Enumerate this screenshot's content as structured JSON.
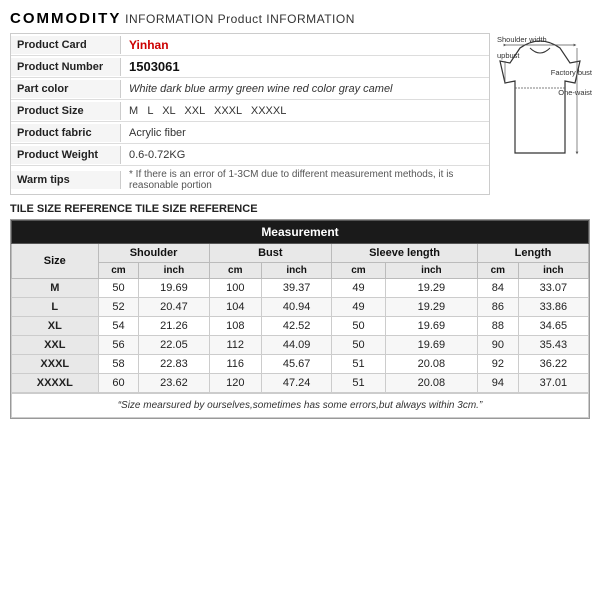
{
  "header": {
    "commodity_bold": "COMMODITY",
    "commodity_rest": " INFORMATION Product INFORMATION"
  },
  "product_info": {
    "rows": [
      {
        "label": "Product Card",
        "value": "Yinhan",
        "type": "highlight"
      },
      {
        "label": "Product Number",
        "value": "1503061",
        "type": "bold"
      },
      {
        "label": "Part color",
        "value": "White dark blue army green wine red color gray camel",
        "type": "part-color"
      },
      {
        "label": "Product Size",
        "value": "M  L  XL  XXL  XXXL  XXXXL",
        "type": "normal"
      },
      {
        "label": "Product fabric",
        "value": "Acrylic fiber",
        "type": "normal"
      },
      {
        "label": "Product Weight",
        "value": "0.6-0.72KG",
        "type": "normal"
      },
      {
        "label": "Warm tips",
        "value": "* If there is an error of 1-3CM due to different measurement methods, it is reasonable portion",
        "type": "warm-tips"
      }
    ]
  },
  "tile_reference": "TILE SIZE REFERENCE TILE SIZE REFERENCE",
  "table": {
    "main_header": "Measurement",
    "column_groups": [
      "Size",
      "Shoulder",
      "Bust",
      "Sleeve length",
      "Length"
    ],
    "unit_row": [
      "",
      "cm",
      "inch",
      "cm",
      "inch",
      "cm",
      "inch",
      "cm",
      "inch"
    ],
    "rows": [
      {
        "size": "M",
        "shoulder_cm": "50",
        "shoulder_in": "19.69",
        "bust_cm": "100",
        "bust_in": "39.37",
        "sleeve_cm": "49",
        "sleeve_in": "19.29",
        "length_cm": "84",
        "length_in": "33.07"
      },
      {
        "size": "L",
        "shoulder_cm": "52",
        "shoulder_in": "20.47",
        "bust_cm": "104",
        "bust_in": "40.94",
        "sleeve_cm": "49",
        "sleeve_in": "19.29",
        "length_cm": "86",
        "length_in": "33.86"
      },
      {
        "size": "XL",
        "shoulder_cm": "54",
        "shoulder_in": "21.26",
        "bust_cm": "108",
        "bust_in": "42.52",
        "sleeve_cm": "50",
        "sleeve_in": "19.69",
        "length_cm": "88",
        "length_in": "34.65"
      },
      {
        "size": "XXL",
        "shoulder_cm": "56",
        "shoulder_in": "22.05",
        "bust_cm": "112",
        "bust_in": "44.09",
        "sleeve_cm": "50",
        "sleeve_in": "19.69",
        "length_cm": "90",
        "length_in": "35.43"
      },
      {
        "size": "XXXL",
        "shoulder_cm": "58",
        "shoulder_in": "22.83",
        "bust_cm": "116",
        "bust_in": "45.67",
        "sleeve_cm": "51",
        "sleeve_in": "20.08",
        "length_cm": "92",
        "length_in": "36.22"
      },
      {
        "size": "XXXXL",
        "shoulder_cm": "60",
        "shoulder_in": "23.62",
        "bust_cm": "120",
        "bust_in": "47.24",
        "sleeve_cm": "51",
        "sleeve_in": "20.08",
        "length_cm": "94",
        "length_in": "37.01"
      }
    ],
    "note": "“Size mearsured by ourselves,sometimes has some errors,but always within 3cm.”"
  },
  "diagram": {
    "labels": {
      "shoulder_width": "Shoulder width",
      "factory_bust": "Factory bust",
      "one_waist": "One-waist",
      "upbust": "upbust"
    }
  }
}
